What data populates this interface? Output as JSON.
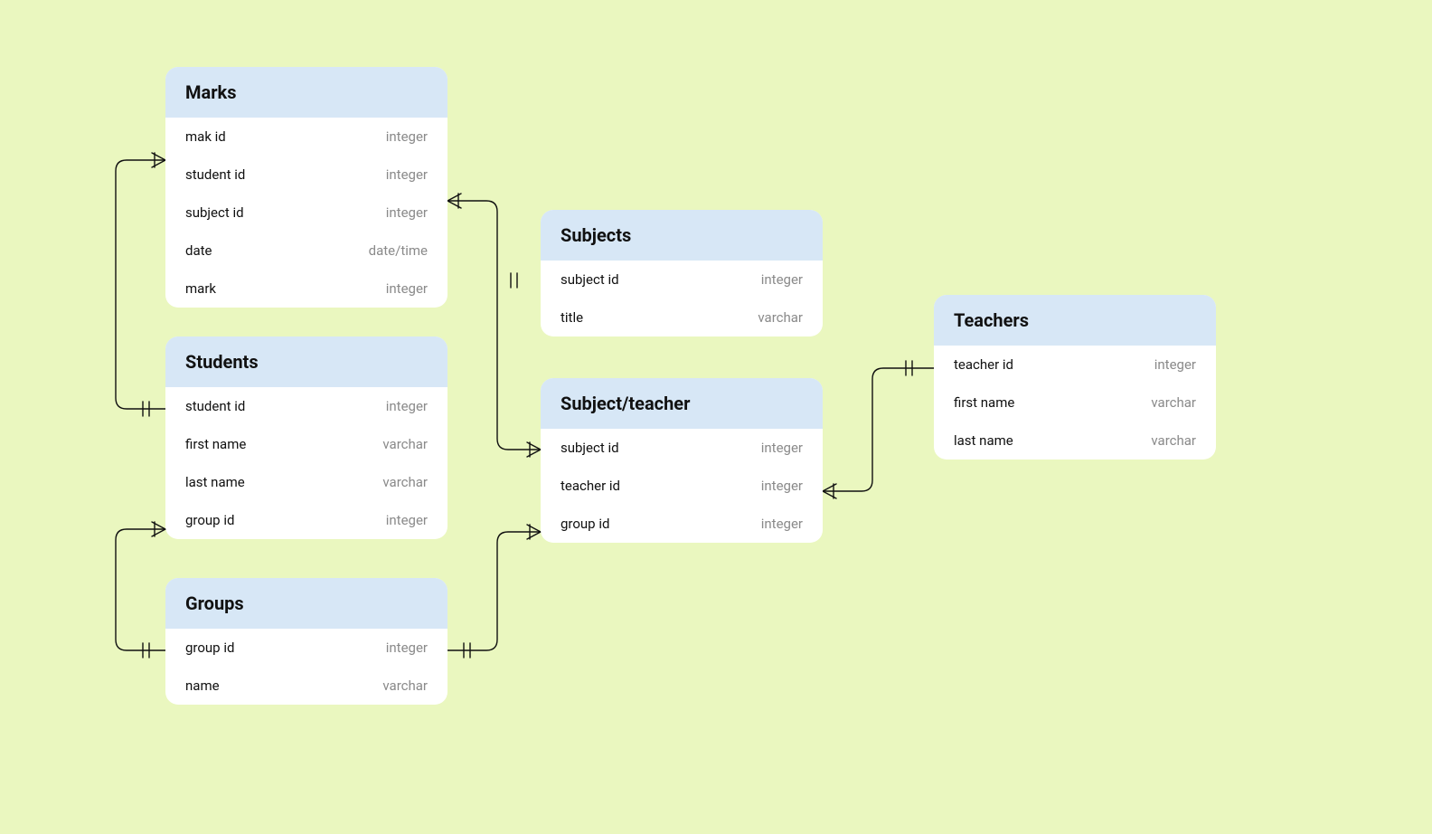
{
  "entities": {
    "marks": {
      "title": "Marks",
      "fields": [
        {
          "name": "mak id",
          "type": "integer"
        },
        {
          "name": "student id",
          "type": "integer"
        },
        {
          "name": "subject id",
          "type": "integer"
        },
        {
          "name": "date",
          "type": "date/time"
        },
        {
          "name": "mark",
          "type": "integer"
        }
      ]
    },
    "students": {
      "title": "Students",
      "fields": [
        {
          "name": "student id",
          "type": "integer"
        },
        {
          "name": "first name",
          "type": "varchar"
        },
        {
          "name": "last name",
          "type": "varchar"
        },
        {
          "name": "group id",
          "type": "integer"
        }
      ]
    },
    "groups": {
      "title": "Groups",
      "fields": [
        {
          "name": "group id",
          "type": "integer"
        },
        {
          "name": "name",
          "type": "varchar"
        }
      ]
    },
    "subjects": {
      "title": "Subjects",
      "fields": [
        {
          "name": "subject id",
          "type": "integer"
        },
        {
          "name": "title",
          "type": "varchar"
        }
      ]
    },
    "subject_teacher": {
      "title": "Subject/teacher",
      "fields": [
        {
          "name": "subject id",
          "type": "integer"
        },
        {
          "name": "teacher id",
          "type": "integer"
        },
        {
          "name": "group id",
          "type": "integer"
        }
      ]
    },
    "teachers": {
      "title": "Teachers",
      "fields": [
        {
          "name": "teacher id",
          "type": "integer"
        },
        {
          "name": "first name",
          "type": "varchar"
        },
        {
          "name": "last name",
          "type": "varchar"
        }
      ]
    }
  },
  "relationships": [
    {
      "from": "marks.student id",
      "to": "students.student id",
      "cardinality": "many-to-one"
    },
    {
      "from": "marks.subject id",
      "to": "subjects.subject id",
      "cardinality": "many-to-one"
    },
    {
      "from": "students.group id",
      "to": "groups.group id",
      "cardinality": "many-to-one"
    },
    {
      "from": "subject_teacher.subject id",
      "to": "subjects.subject id",
      "cardinality": "many-to-one"
    },
    {
      "from": "subject_teacher.teacher id",
      "to": "teachers.teacher id",
      "cardinality": "many-to-one"
    },
    {
      "from": "subject_teacher.group id",
      "to": "groups.group id",
      "cardinality": "many-to-one"
    }
  ]
}
